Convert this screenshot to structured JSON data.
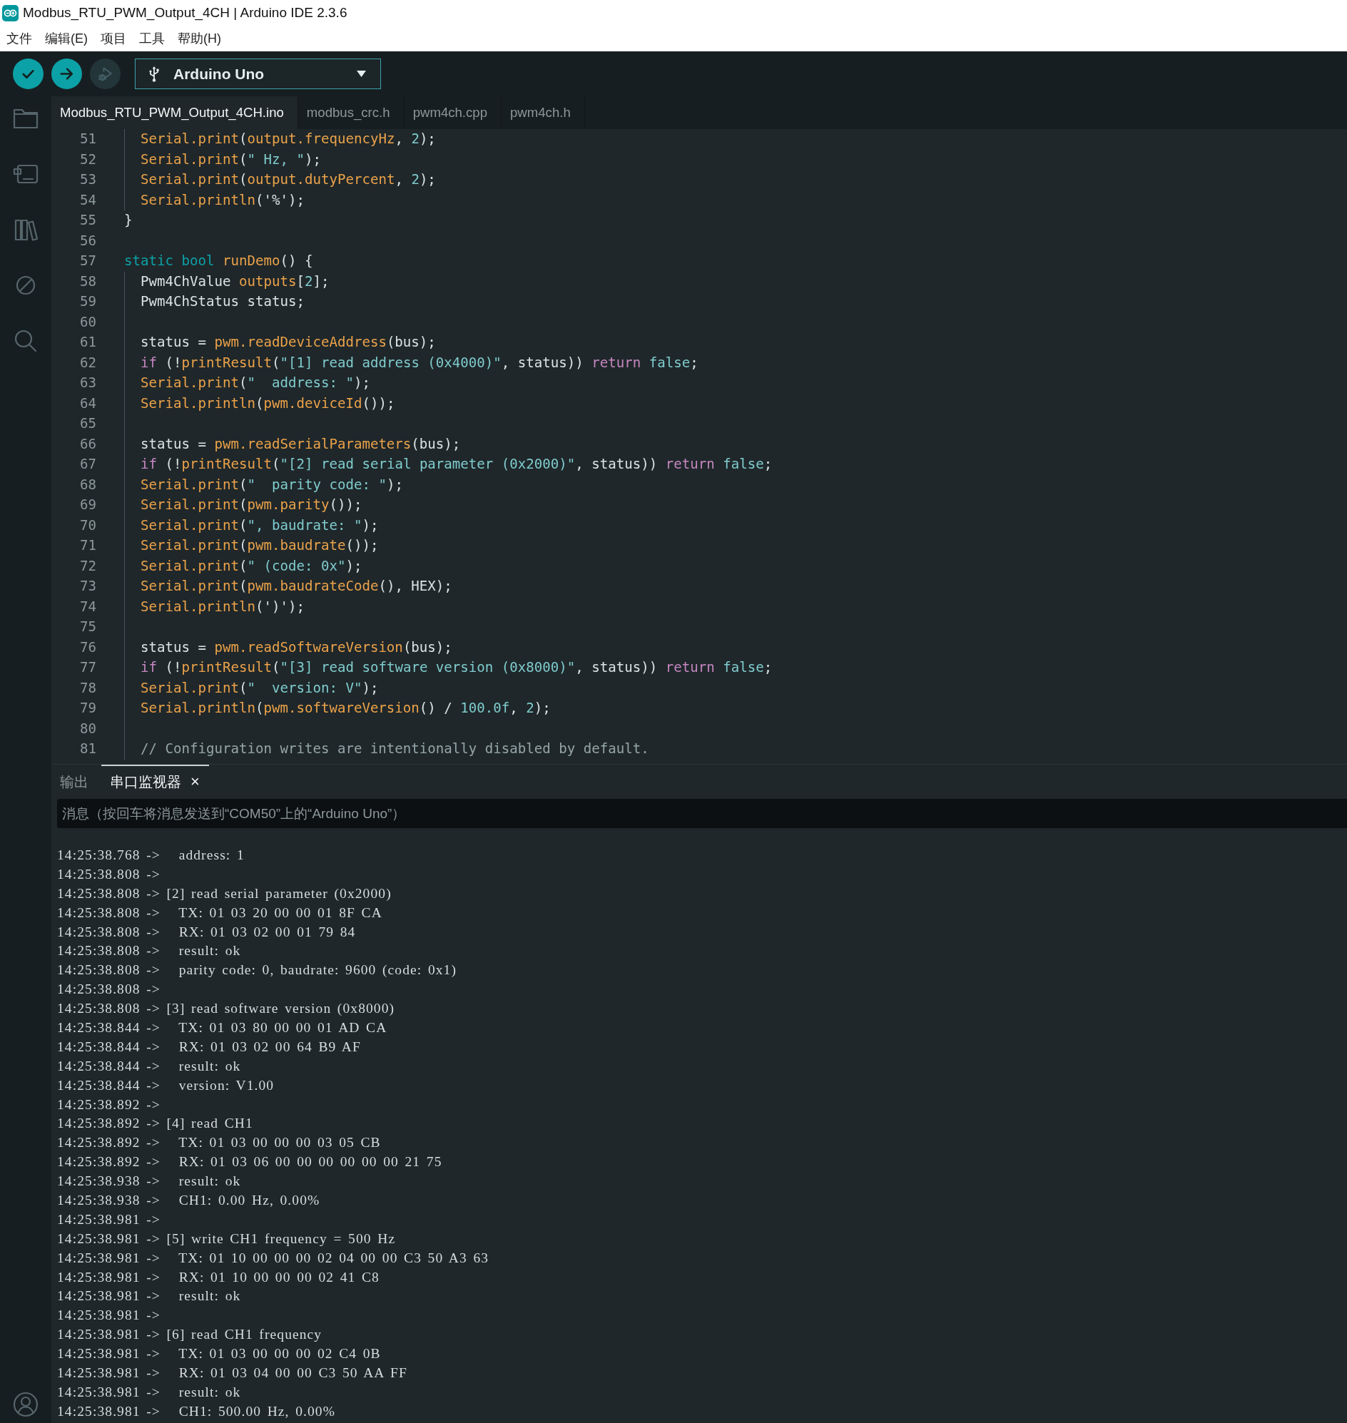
{
  "window": {
    "title": "Modbus_RTU_PWM_Output_4CH | Arduino IDE 2.3.6"
  },
  "menu": [
    "文件",
    "编辑(E)",
    "项目",
    "工具",
    "帮助(H)"
  ],
  "toolbar": {
    "buttons": [
      {
        "kind": "verify",
        "disabled": false
      },
      {
        "kind": "upload",
        "disabled": false
      },
      {
        "kind": "debug",
        "disabled": true
      }
    ],
    "board": "Arduino Uno"
  },
  "editor": {
    "tabs": [
      {
        "label": "Modbus_RTU_PWM_Output_4CH.ino",
        "selected": true
      },
      {
        "label": "modbus_crc.h",
        "selected": false
      },
      {
        "label": "pwm4ch.cpp",
        "selected": false
      },
      {
        "label": "pwm4ch.h",
        "selected": false
      }
    ],
    "lines": [
      {
        "children": [
          {
            "number": "51",
            "tokens": [
              {
                "kind": "func",
                "text": "Serial.print"
              },
              {
                "kind": "plain",
                "text": "("
              },
              {
                "kind": "func",
                "text": "output.frequencyHz"
              },
              {
                "kind": "plain",
                "text": ", "
              },
              {
                "kind": "number",
                "text": "2"
              },
              {
                "kind": "plain",
                "text": ");"
              }
            ]
          },
          {
            "number": "52",
            "tokens": [
              {
                "kind": "func",
                "text": "Serial.print"
              },
              {
                "kind": "plain",
                "text": "("
              },
              {
                "kind": "string",
                "text": "\" Hz, \""
              },
              {
                "kind": "plain",
                "text": ");"
              }
            ]
          },
          {
            "number": "53",
            "tokens": [
              {
                "kind": "func",
                "text": "Serial.print"
              },
              {
                "kind": "plain",
                "text": "("
              },
              {
                "kind": "func",
                "text": "output.dutyPercent"
              },
              {
                "kind": "plain",
                "text": ", "
              },
              {
                "kind": "number",
                "text": "2"
              },
              {
                "kind": "plain",
                "text": ");"
              }
            ]
          },
          {
            "number": "54",
            "tokens": [
              {
                "kind": "func",
                "text": "Serial.println"
              },
              {
                "kind": "plain",
                "text": "('%');"
              }
            ]
          }
        ]
      },
      {
        "number": "55",
        "tokens": [
          {
            "kind": "plain",
            "text": "}"
          }
        ]
      },
      {
        "number": "56"
      },
      {
        "number": "57",
        "tokens": [
          {
            "kind": "keyword",
            "text": "static bool "
          },
          {
            "kind": "func",
            "text": "runDemo"
          },
          {
            "kind": "plain",
            "text": "() {"
          }
        ],
        "children": [
          {
            "number": "58",
            "tokens": [
              {
                "kind": "plain",
                "text": "Pwm4ChValue "
              },
              {
                "kind": "func",
                "text": "outputs"
              },
              {
                "kind": "plain",
                "text": "["
              },
              {
                "kind": "number",
                "text": "2"
              },
              {
                "kind": "plain",
                "text": "];"
              }
            ]
          },
          {
            "number": "59",
            "tokens": [
              {
                "kind": "plain",
                "text": "Pwm4ChStatus status;"
              }
            ]
          },
          {
            "number": "60"
          },
          {
            "number": "61",
            "tokens": [
              {
                "kind": "plain",
                "text": "status = "
              },
              {
                "kind": "func",
                "text": "pwm.readDeviceAddress"
              },
              {
                "kind": "plain",
                "text": "(bus);"
              }
            ]
          },
          {
            "number": "62",
            "tokens": [
              {
                "kind": "control",
                "text": "if"
              },
              {
                "kind": "plain",
                "text": " (!"
              },
              {
                "kind": "func",
                "text": "printResult"
              },
              {
                "kind": "plain",
                "text": "("
              },
              {
                "kind": "string",
                "text": "\"[1] read address (0x4000)\""
              },
              {
                "kind": "plain",
                "text": ", status)) "
              },
              {
                "kind": "control",
                "text": "return "
              },
              {
                "kind": "literal",
                "text": "false"
              },
              {
                "kind": "plain",
                "text": ";"
              }
            ]
          },
          {
            "number": "63",
            "tokens": [
              {
                "kind": "func",
                "text": "Serial.print"
              },
              {
                "kind": "plain",
                "text": "("
              },
              {
                "kind": "string",
                "text": "\"  address: \""
              },
              {
                "kind": "plain",
                "text": ");"
              }
            ]
          },
          {
            "number": "64",
            "tokens": [
              {
                "kind": "func",
                "text": "Serial.println"
              },
              {
                "kind": "plain",
                "text": "("
              },
              {
                "kind": "func",
                "text": "pwm.deviceId"
              },
              {
                "kind": "plain",
                "text": "());"
              }
            ]
          },
          {
            "number": "65"
          },
          {
            "number": "66",
            "tokens": [
              {
                "kind": "plain",
                "text": "status = "
              },
              {
                "kind": "func",
                "text": "pwm.readSerialParameters"
              },
              {
                "kind": "plain",
                "text": "(bus);"
              }
            ]
          },
          {
            "number": "67",
            "tokens": [
              {
                "kind": "control",
                "text": "if"
              },
              {
                "kind": "plain",
                "text": " (!"
              },
              {
                "kind": "func",
                "text": "printResult"
              },
              {
                "kind": "plain",
                "text": "("
              },
              {
                "kind": "string",
                "text": "\"[2] read serial parameter (0x2000)\""
              },
              {
                "kind": "plain",
                "text": ", status)) "
              },
              {
                "kind": "control",
                "text": "return "
              },
              {
                "kind": "literal",
                "text": "false"
              },
              {
                "kind": "plain",
                "text": ";"
              }
            ]
          },
          {
            "number": "68",
            "tokens": [
              {
                "kind": "func",
                "text": "Serial.print"
              },
              {
                "kind": "plain",
                "text": "("
              },
              {
                "kind": "string",
                "text": "\"  parity code: \""
              },
              {
                "kind": "plain",
                "text": ");"
              }
            ]
          },
          {
            "number": "69",
            "tokens": [
              {
                "kind": "func",
                "text": "Serial.print"
              },
              {
                "kind": "plain",
                "text": "("
              },
              {
                "kind": "func",
                "text": "pwm.parity"
              },
              {
                "kind": "plain",
                "text": "());"
              }
            ]
          },
          {
            "number": "70",
            "tokens": [
              {
                "kind": "func",
                "text": "Serial.print"
              },
              {
                "kind": "plain",
                "text": "("
              },
              {
                "kind": "string",
                "text": "\", baudrate: \""
              },
              {
                "kind": "plain",
                "text": ");"
              }
            ]
          },
          {
            "number": "71",
            "tokens": [
              {
                "kind": "func",
                "text": "Serial.print"
              },
              {
                "kind": "plain",
                "text": "("
              },
              {
                "kind": "func",
                "text": "pwm.baudrate"
              },
              {
                "kind": "plain",
                "text": "());"
              }
            ]
          },
          {
            "number": "72",
            "tokens": [
              {
                "kind": "func",
                "text": "Serial.print"
              },
              {
                "kind": "plain",
                "text": "("
              },
              {
                "kind": "string",
                "text": "\" (code: 0x\""
              },
              {
                "kind": "plain",
                "text": ");"
              }
            ]
          },
          {
            "number": "73",
            "tokens": [
              {
                "kind": "func",
                "text": "Serial.print"
              },
              {
                "kind": "plain",
                "text": "("
              },
              {
                "kind": "func",
                "text": "pwm.baudrateCode"
              },
              {
                "kind": "plain",
                "text": "(), HEX);"
              }
            ]
          },
          {
            "number": "74",
            "tokens": [
              {
                "kind": "func",
                "text": "Serial.println"
              },
              {
                "kind": "plain",
                "text": "(')');"
              }
            ]
          },
          {
            "number": "75"
          },
          {
            "number": "76",
            "tokens": [
              {
                "kind": "plain",
                "text": "status = "
              },
              {
                "kind": "func",
                "text": "pwm.readSoftwareVersion"
              },
              {
                "kind": "plain",
                "text": "(bus);"
              }
            ]
          },
          {
            "number": "77",
            "tokens": [
              {
                "kind": "control",
                "text": "if"
              },
              {
                "kind": "plain",
                "text": " (!"
              },
              {
                "kind": "func",
                "text": "printResult"
              },
              {
                "kind": "plain",
                "text": "("
              },
              {
                "kind": "string",
                "text": "\"[3] read software version (0x8000)\""
              },
              {
                "kind": "plain",
                "text": ", status)) "
              },
              {
                "kind": "control",
                "text": "return "
              },
              {
                "kind": "literal",
                "text": "false"
              },
              {
                "kind": "plain",
                "text": ";"
              }
            ]
          },
          {
            "number": "78",
            "tokens": [
              {
                "kind": "func",
                "text": "Serial.print"
              },
              {
                "kind": "plain",
                "text": "("
              },
              {
                "kind": "string",
                "text": "\"  version: V\""
              },
              {
                "kind": "plain",
                "text": ");"
              }
            ]
          },
          {
            "number": "79",
            "tokens": [
              {
                "kind": "func",
                "text": "Serial.println"
              },
              {
                "kind": "plain",
                "text": "("
              },
              {
                "kind": "func",
                "text": "pwm.softwareVersion"
              },
              {
                "kind": "plain",
                "text": "() / "
              },
              {
                "kind": "number",
                "text": "100.0f"
              },
              {
                "kind": "plain",
                "text": ", "
              },
              {
                "kind": "number",
                "text": "2"
              },
              {
                "kind": "plain",
                "text": ");"
              }
            ]
          },
          {
            "number": "80"
          },
          {
            "number": "81",
            "tokens": [
              {
                "kind": "comment",
                "text": "// Configuration writes are intentionally disabled by default."
              }
            ]
          }
        ]
      }
    ]
  },
  "panel": {
    "tabs": [
      {
        "label": "输出",
        "selected": false
      },
      {
        "label": "串口监视器",
        "selected": true,
        "close": "×"
      }
    ],
    "message": {
      "placeholder": "消息（按回车将消息发送到“COM50”上的“Arduino Uno”）"
    },
    "output": [
      "14:25:38.768 ->   address: 1",
      "14:25:38.808 ->",
      "14:25:38.808 -> [2] read serial parameter (0x2000)",
      "14:25:38.808 ->   TX: 01 03 20 00 00 01 8F CA",
      "14:25:38.808 ->   RX: 01 03 02 00 01 79 84",
      "14:25:38.808 ->   result: ok",
      "14:25:38.808 ->   parity code: 0, baudrate: 9600 (code: 0x1)",
      "14:25:38.808 ->",
      "14:25:38.808 -> [3] read software version (0x8000)",
      "14:25:38.844 ->   TX: 01 03 80 00 00 01 AD CA",
      "14:25:38.844 ->   RX: 01 03 02 00 64 B9 AF",
      "14:25:38.844 ->   result: ok",
      "14:25:38.844 ->   version: V1.00",
      "14:25:38.892 ->",
      "14:25:38.892 -> [4] read CH1",
      "14:25:38.892 ->   TX: 01 03 00 00 00 03 05 CB",
      "14:25:38.892 ->   RX: 01 03 06 00 00 00 00 00 00 21 75",
      "14:25:38.938 ->   result: ok",
      "14:25:38.938 ->   CH1: 0.00 Hz, 0.00%",
      "14:25:38.981 ->",
      "14:25:38.981 -> [5] write CH1 frequency = 500 Hz",
      "14:25:38.981 ->   TX: 01 10 00 00 00 02 04 00 00 C3 50 A3 63",
      "14:25:38.981 ->   RX: 01 10 00 00 00 02 41 C8",
      "14:25:38.981 ->   result: ok",
      "14:25:38.981 ->",
      "14:25:38.981 -> [6] read CH1 frequency",
      "14:25:38.981 ->   TX: 01 03 00 00 00 02 C4 0B",
      "14:25:38.981 ->   RX: 01 03 04 00 00 C3 50 AA FF",
      "14:25:38.981 ->   result: ok",
      "14:25:38.981 ->   CH1: 500.00 Hz, 0.00%"
    ]
  }
}
